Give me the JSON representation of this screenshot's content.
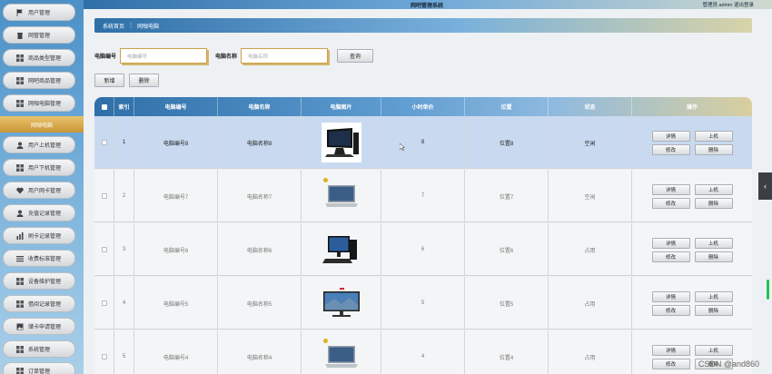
{
  "topbar": {
    "title": "网吧管理系统",
    "user_text": "管理员 admin  退出登录"
  },
  "sidebar": {
    "items": [
      {
        "label": "用户管理",
        "icon": "flag-icon"
      },
      {
        "label": "网管管理",
        "icon": "trash-icon"
      },
      {
        "label": "商品类型管理",
        "icon": "grid-icon"
      },
      {
        "label": "网吧商品管理",
        "icon": "grid-icon"
      },
      {
        "label": "网咖电脑管理",
        "icon": "grid-icon"
      }
    ],
    "active": "网咖电脑",
    "items2": [
      {
        "label": "用户上机管理",
        "icon": "user-icon"
      },
      {
        "label": "用户下机管理",
        "icon": "grid-icon"
      },
      {
        "label": "用户网卡管理",
        "icon": "heart-icon"
      },
      {
        "label": "充值记录管理",
        "icon": "user-icon"
      },
      {
        "label": "刷卡记录管理",
        "icon": "chart-icon"
      },
      {
        "label": "收费标准管理",
        "icon": "list-icon"
      },
      {
        "label": "设备维护管理",
        "icon": "grid-icon"
      },
      {
        "label": "借阅记录管理",
        "icon": "grid-icon"
      },
      {
        "label": "储卡申请管理",
        "icon": "image-icon"
      },
      {
        "label": "系统管理",
        "icon": "grid-icon"
      },
      {
        "label": "订单管理",
        "icon": "grid-icon"
      }
    ]
  },
  "breadcrumb": {
    "home": "系统首页",
    "sep": "⋮",
    "current": "网咖电脑"
  },
  "search": {
    "number_label": "电脑编号",
    "number_placeholder": "电脑编号",
    "name_label": "电脑名称",
    "name_placeholder": "电脑名称",
    "query_button": "查询"
  },
  "actions": {
    "add_button": "新增",
    "delete_button": "删除"
  },
  "table": {
    "headers": [
      "索引",
      "电脑编号",
      "电脑名称",
      "电脑图片",
      "小时单价",
      "位置",
      "状态",
      "操作"
    ],
    "rows": [
      {
        "index": "1",
        "number": "电脑编号8",
        "name": "电脑名称8",
        "price": "8",
        "location": "位置8",
        "status": "空闲",
        "image": "desktop-monitor-icon",
        "selected": true
      },
      {
        "index": "2",
        "number": "电脑编号7",
        "name": "电脑名称7",
        "price": "7",
        "location": "位置7",
        "status": "空闲",
        "image": "laptop-icon",
        "selected": false
      },
      {
        "index": "3",
        "number": "电脑编号6",
        "name": "电脑名称6",
        "price": "6",
        "location": "位置6",
        "status": "占用",
        "image": "desktop-set-icon",
        "selected": false
      },
      {
        "index": "4",
        "number": "电脑编号5",
        "name": "电脑名称5",
        "price": "5",
        "location": "位置5",
        "status": "占用",
        "image": "wide-monitor-icon",
        "selected": false
      },
      {
        "index": "5",
        "number": "电脑编号4",
        "name": "电脑名称4",
        "price": "4",
        "location": "位置4",
        "status": "占用",
        "image": "laptop-icon",
        "selected": false
      }
    ],
    "op_labels": {
      "detail": "详情",
      "online": "上机",
      "edit": "修改",
      "delete": "删除"
    }
  },
  "watermark": "CSDN @and860",
  "colors": {
    "accent": "#2f6fa8",
    "active": "#c99535",
    "selected_row": "#c9daf0"
  }
}
